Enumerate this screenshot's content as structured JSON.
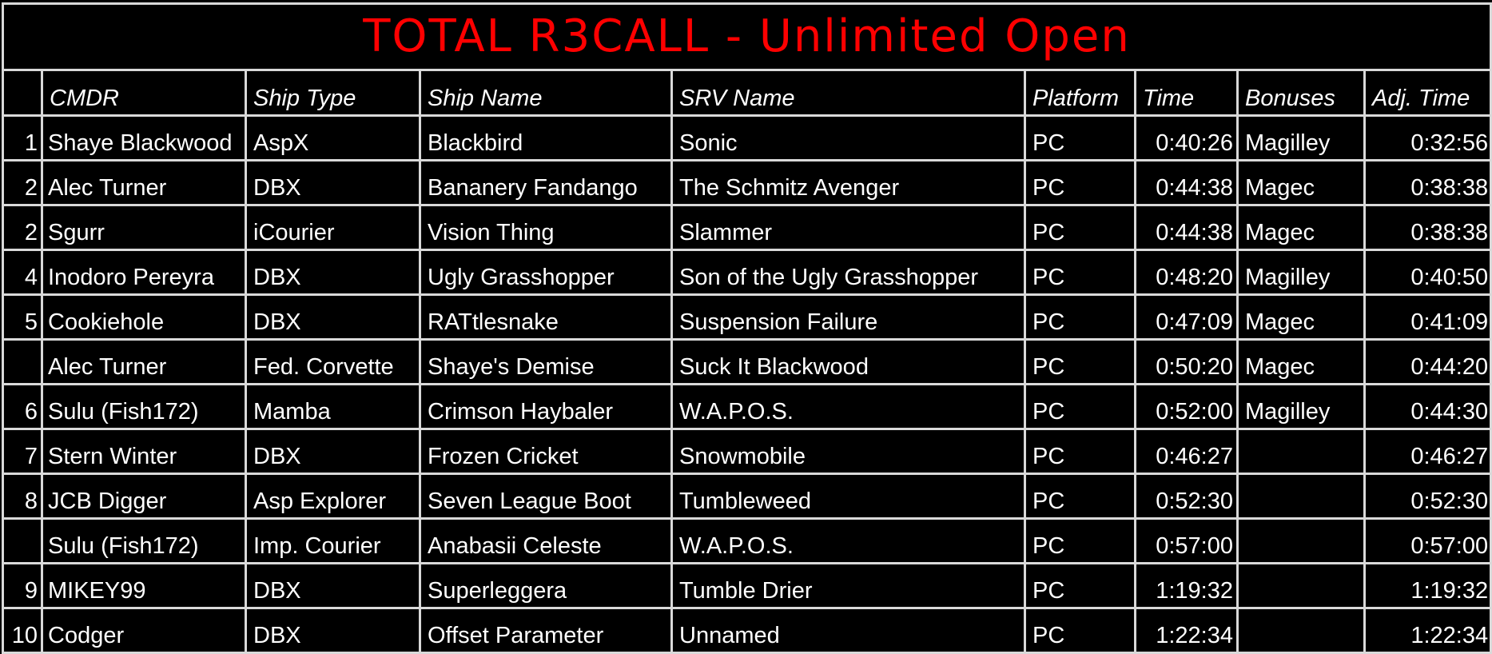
{
  "title": "TOTAL R3CALL - Unlimited Open",
  "colors": {
    "title": "#ff0000",
    "text": "#ffffff",
    "background": "#000000",
    "grid": "#d9d9d9"
  },
  "columns": [
    "",
    "CMDR",
    "Ship Type",
    "Ship Name",
    "SRV Name",
    "Platform",
    "Time",
    "Bonuses",
    "Adj. Time"
  ],
  "rows": [
    {
      "rank": "1",
      "cmdr": "Shaye Blackwood",
      "ship_type": "AspX",
      "ship_name": "Blackbird",
      "srv_name": "Sonic",
      "platform": "PC",
      "time": "0:40:26",
      "bonuses": "Magilley",
      "adj_time": "0:32:56"
    },
    {
      "rank": "2",
      "cmdr": "Alec Turner",
      "ship_type": "DBX",
      "ship_name": "Bananery Fandango",
      "srv_name": "The Schmitz Avenger",
      "platform": "PC",
      "time": "0:44:38",
      "bonuses": "Magec",
      "adj_time": "0:38:38"
    },
    {
      "rank": "2",
      "cmdr": "Sgurr",
      "ship_type": "iCourier",
      "ship_name": "Vision Thing",
      "srv_name": "Slammer",
      "platform": "PC",
      "time": "0:44:38",
      "bonuses": "Magec",
      "adj_time": "0:38:38"
    },
    {
      "rank": "4",
      "cmdr": "Inodoro Pereyra",
      "ship_type": "DBX",
      "ship_name": "Ugly Grasshopper",
      "srv_name": "Son of the Ugly Grasshopper",
      "platform": "PC",
      "time": "0:48:20",
      "bonuses": "Magilley",
      "adj_time": "0:40:50"
    },
    {
      "rank": "5",
      "cmdr": "Cookiehole",
      "ship_type": "DBX",
      "ship_name": "RATtlesnake",
      "srv_name": "Suspension Failure",
      "platform": "PC",
      "time": "0:47:09",
      "bonuses": "Magec",
      "adj_time": "0:41:09"
    },
    {
      "rank": "",
      "cmdr": "Alec Turner",
      "ship_type": "Fed. Corvette",
      "ship_name": "Shaye's Demise",
      "srv_name": "Suck It Blackwood",
      "platform": "PC",
      "time": "0:50:20",
      "bonuses": "Magec",
      "adj_time": "0:44:20"
    },
    {
      "rank": "6",
      "cmdr": "Sulu (Fish172)",
      "ship_type": "Mamba",
      "ship_name": "Crimson Haybaler",
      "srv_name": "W.A.P.O.S.",
      "platform": "PC",
      "time": "0:52:00",
      "bonuses": "Magilley",
      "adj_time": "0:44:30"
    },
    {
      "rank": "7",
      "cmdr": "Stern Winter",
      "ship_type": "DBX",
      "ship_name": "Frozen Cricket",
      "srv_name": "Snowmobile",
      "platform": "PC",
      "time": "0:46:27",
      "bonuses": "",
      "adj_time": "0:46:27"
    },
    {
      "rank": "8",
      "cmdr": "JCB Digger",
      "ship_type": "Asp Explorer",
      "ship_name": "Seven League Boot",
      "srv_name": "Tumbleweed",
      "platform": "PC",
      "time": "0:52:30",
      "bonuses": "",
      "adj_time": "0:52:30"
    },
    {
      "rank": "",
      "cmdr": "Sulu (Fish172)",
      "ship_type": "Imp. Courier",
      "ship_name": "Anabasii Celeste",
      "srv_name": "W.A.P.O.S.",
      "platform": "PC",
      "time": "0:57:00",
      "bonuses": "",
      "adj_time": "0:57:00"
    },
    {
      "rank": "9",
      "cmdr": "MIKEY99",
      "ship_type": "DBX",
      "ship_name": "Superleggera",
      "srv_name": "Tumble Drier",
      "platform": "PC",
      "time": "1:19:32",
      "bonuses": "",
      "adj_time": "1:19:32"
    },
    {
      "rank": "10",
      "cmdr": "Codger",
      "ship_type": "DBX",
      "ship_name": "Offset Parameter",
      "srv_name": "Unnamed",
      "platform": "PC",
      "time": "1:22:34",
      "bonuses": "",
      "adj_time": "1:22:34"
    }
  ]
}
